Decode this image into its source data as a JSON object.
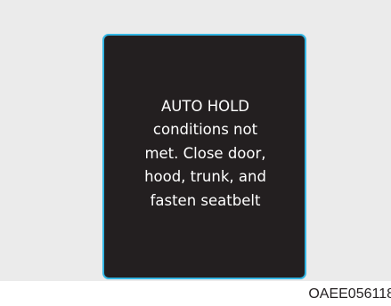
{
  "display": {
    "lines": [
      "AUTO HOLD",
      "conditions not",
      "met. Close door,",
      "hood, trunk, and",
      "fasten seatbelt"
    ]
  },
  "figure_code": "OAEE056118",
  "colors": {
    "panel_bg": "#ebebeb",
    "display_bg": "#231f20",
    "display_border": "#33b6e4",
    "text": "#ffffff"
  }
}
